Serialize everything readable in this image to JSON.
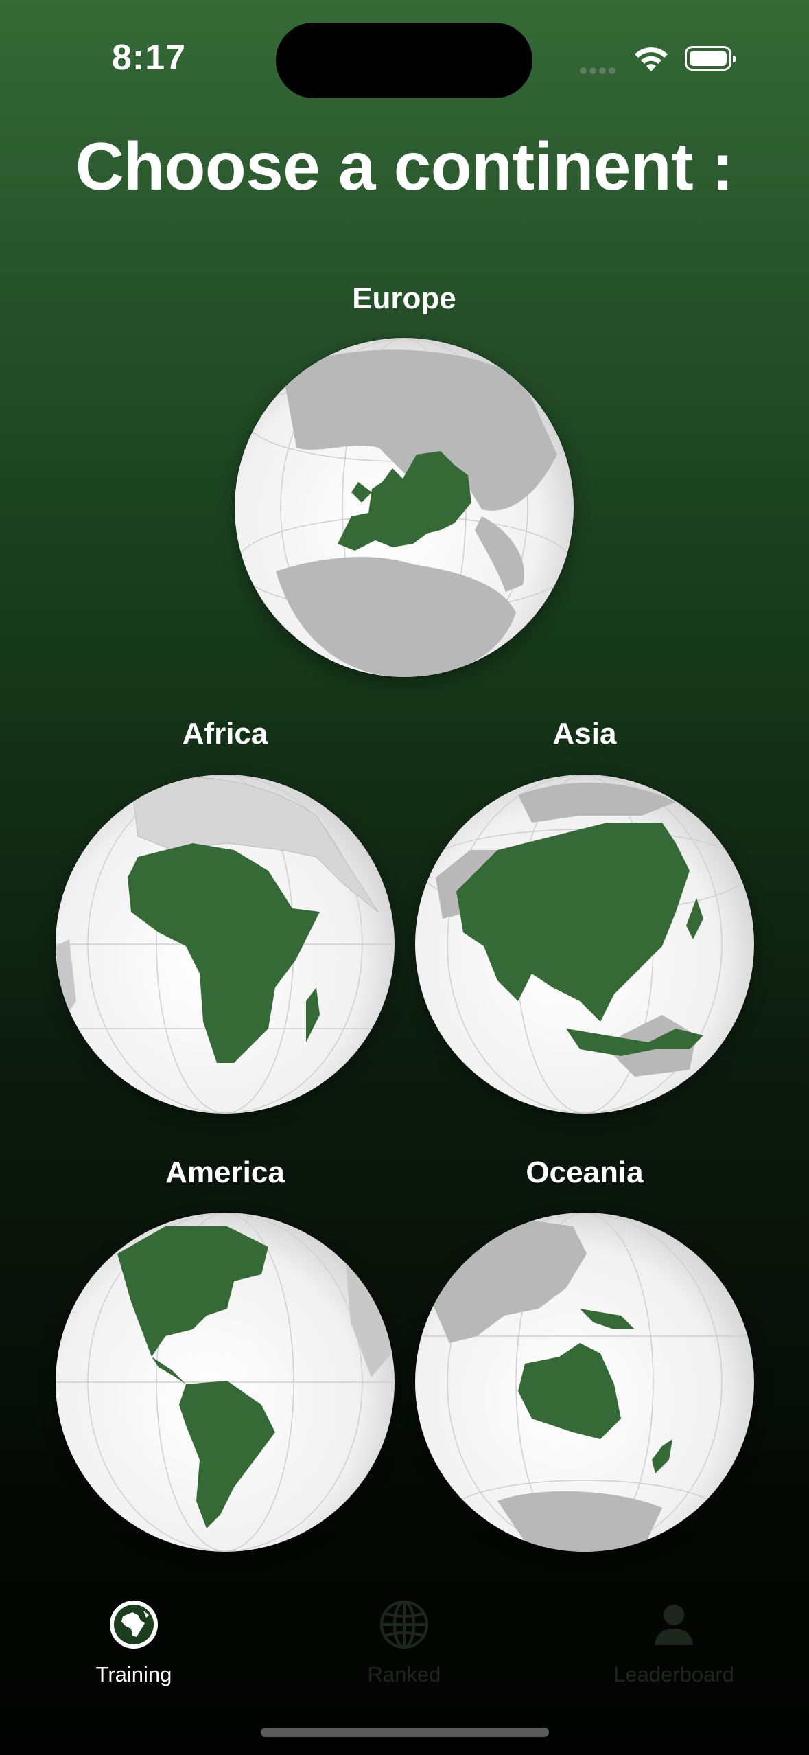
{
  "status_bar": {
    "time": "8:17"
  },
  "page_title": "Choose a continent :",
  "continents": [
    {
      "name": "Europe"
    },
    {
      "name": "Africa"
    },
    {
      "name": "Asia"
    },
    {
      "name": "America"
    },
    {
      "name": "Oceania"
    }
  ],
  "tab_bar": {
    "items": [
      {
        "label": "Training",
        "icon": "globe-africa-icon",
        "active": true
      },
      {
        "label": "Ranked",
        "icon": "globe-grid-icon",
        "active": false
      },
      {
        "label": "Leaderboard",
        "icon": "person-icon",
        "active": false
      }
    ]
  },
  "colors": {
    "highlight_green": "#356a36",
    "land_gray": "#b4b4b4",
    "ocean_white": "#f4f4f4"
  }
}
